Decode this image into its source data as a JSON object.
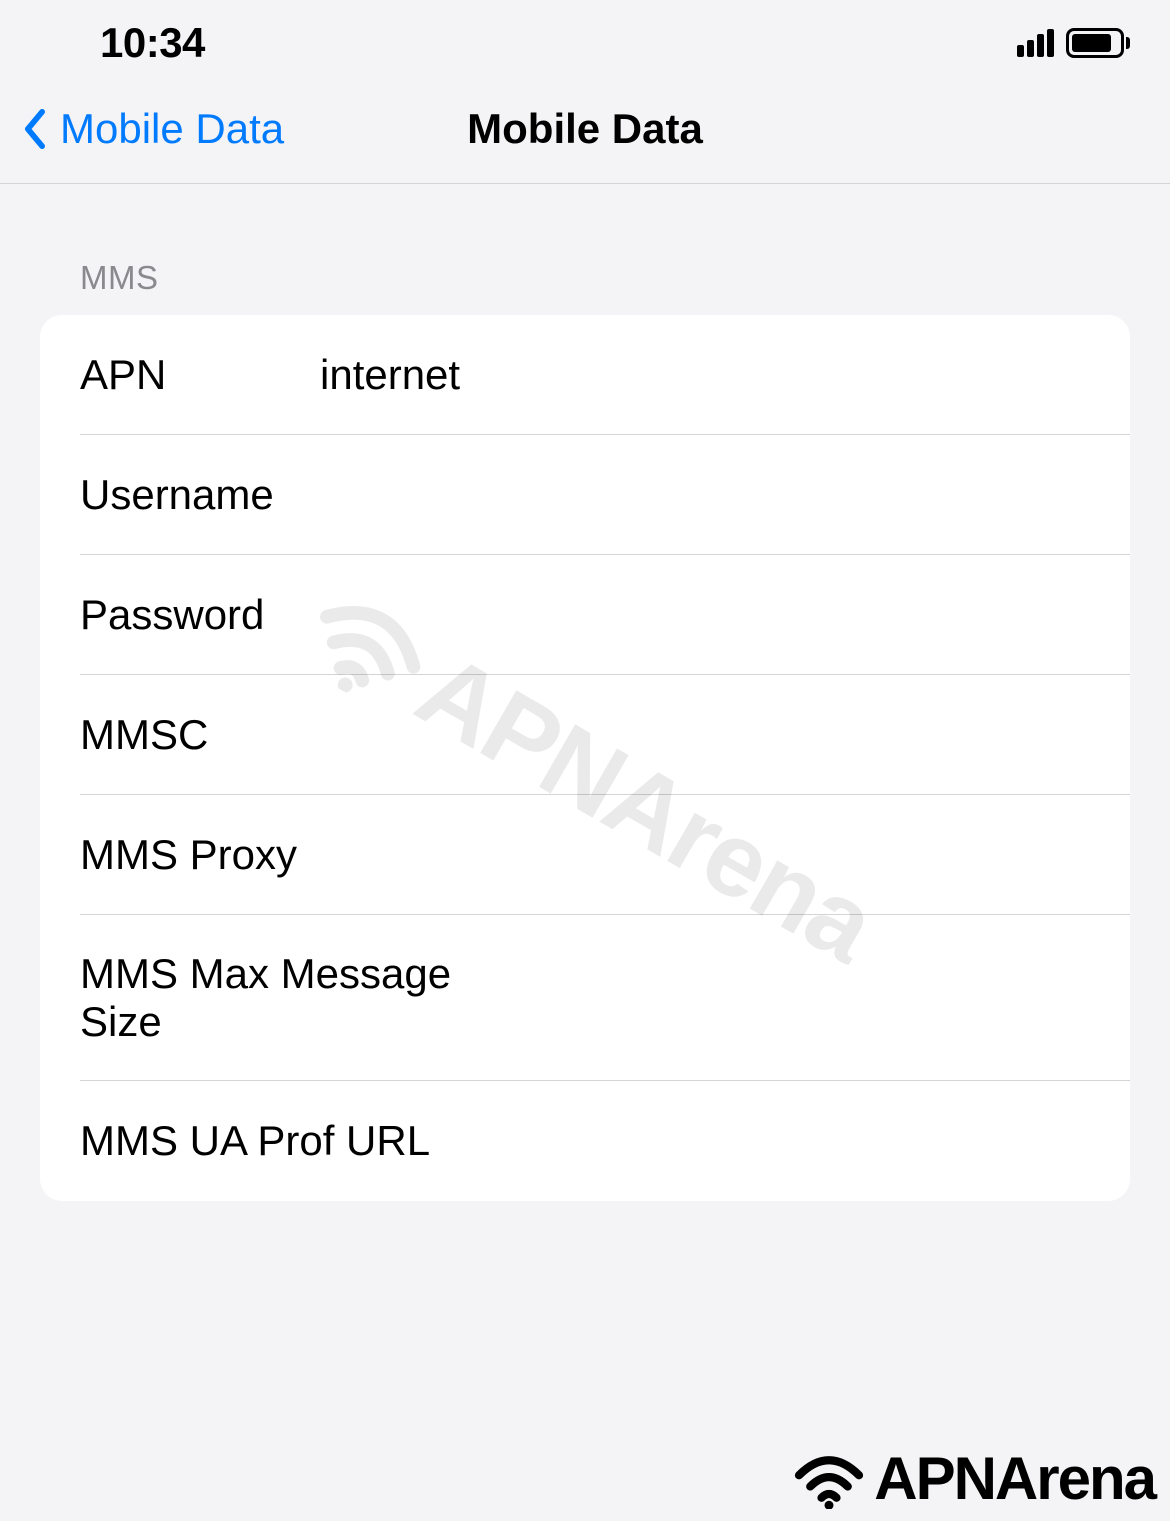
{
  "status": {
    "time": "10:34"
  },
  "nav": {
    "back_label": "Mobile Data",
    "title": "Mobile Data"
  },
  "section": {
    "header": "MMS",
    "rows": [
      {
        "label": "APN",
        "value": "internet"
      },
      {
        "label": "Username",
        "value": ""
      },
      {
        "label": "Password",
        "value": ""
      },
      {
        "label": "MMSC",
        "value": ""
      },
      {
        "label": "MMS Proxy",
        "value": ""
      },
      {
        "label": "MMS Max Message Size",
        "value": ""
      },
      {
        "label": "MMS UA Prof URL",
        "value": ""
      }
    ]
  },
  "branding": {
    "watermark": "APNArena",
    "footer": "APNArena"
  }
}
